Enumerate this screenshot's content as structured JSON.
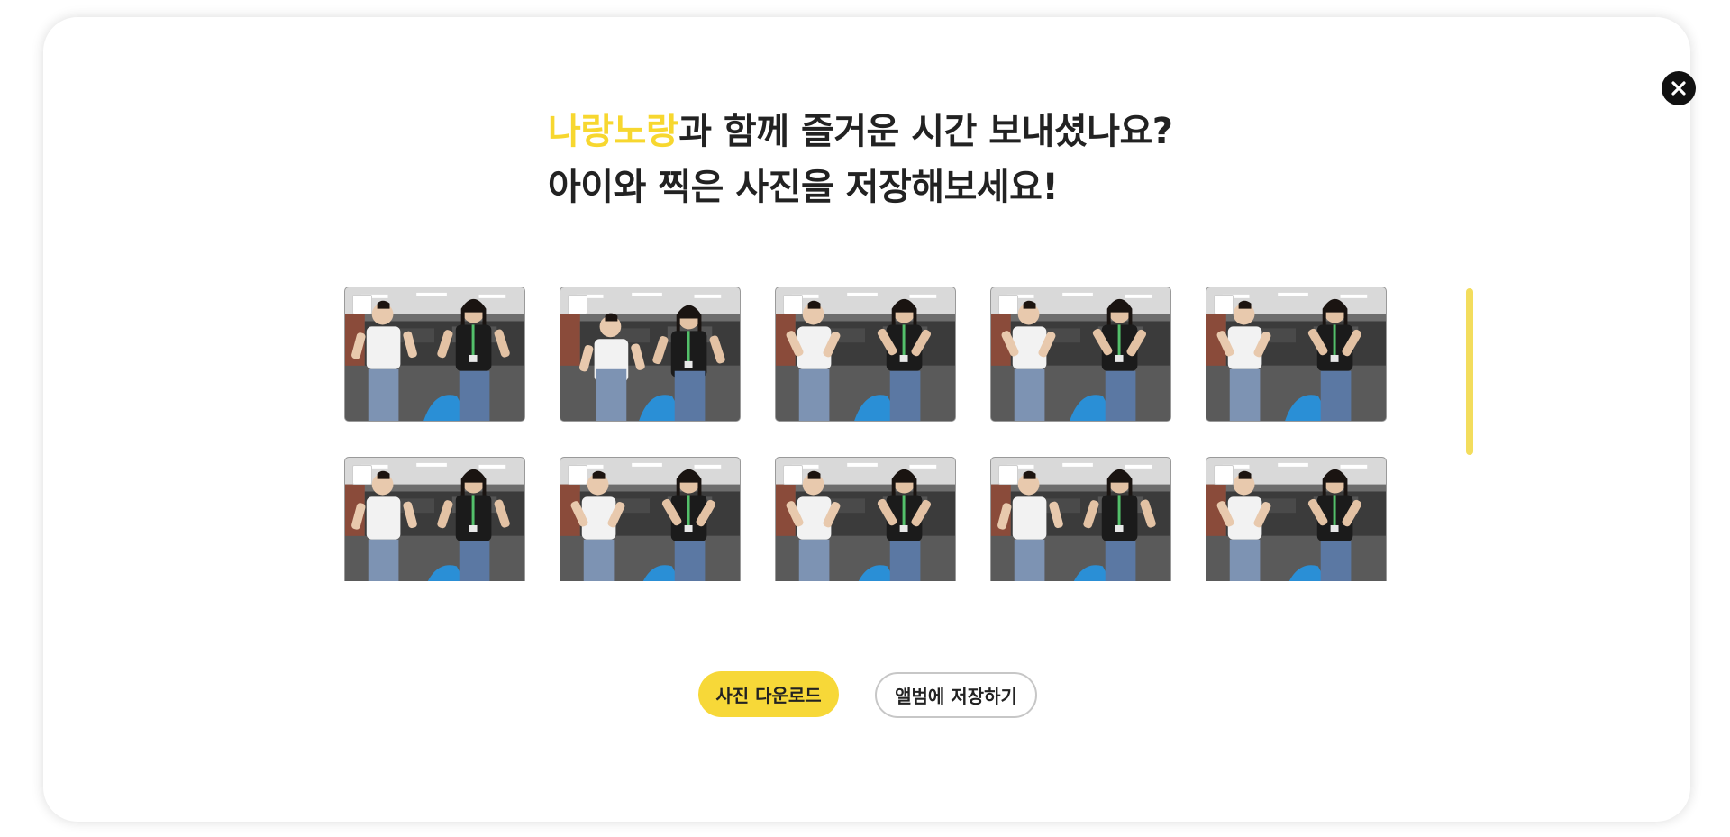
{
  "modal": {
    "close_icon": "close-icon",
    "headline": {
      "accent": "나랑노랑",
      "line1_rest": "과 함께 즐거운 시간 보내셨나요?",
      "line2": "아이와 찍은 사진을 저장해보세요!"
    },
    "colors": {
      "accent": "#f7d72f",
      "button_primary": "#f7d838",
      "scrollbar": "#f3dd5d",
      "text": "#222222"
    },
    "gallery": {
      "rows": [
        [
          {
            "selected": false,
            "left_shirt": "white",
            "right_shirt": "black",
            "pose": "hands-on-hips"
          },
          {
            "selected": false,
            "left_shirt": "white",
            "right_shirt": "black",
            "pose": "leaning-forward"
          },
          {
            "selected": false,
            "left_shirt": "white",
            "right_shirt": "black",
            "pose": "dancing"
          },
          {
            "selected": false,
            "left_shirt": "white",
            "right_shirt": "black",
            "pose": "dancing"
          },
          {
            "selected": false,
            "left_shirt": "white",
            "right_shirt": "black",
            "pose": "dancing"
          }
        ],
        [
          {
            "selected": false,
            "left_shirt": "white",
            "right_shirt": "black",
            "pose": "hands-on-hips"
          },
          {
            "selected": false,
            "left_shirt": "white",
            "right_shirt": "black",
            "pose": "dancing"
          },
          {
            "selected": false,
            "left_shirt": "white",
            "right_shirt": "black",
            "pose": "dancing"
          },
          {
            "selected": false,
            "left_shirt": "white",
            "right_shirt": "black",
            "pose": "hands-on-hips"
          },
          {
            "selected": false,
            "left_shirt": "white",
            "right_shirt": "black",
            "pose": "dancing"
          }
        ]
      ]
    },
    "buttons": {
      "download_label": "사진 다운로드",
      "album_label": "앨범에 저장하기"
    }
  }
}
